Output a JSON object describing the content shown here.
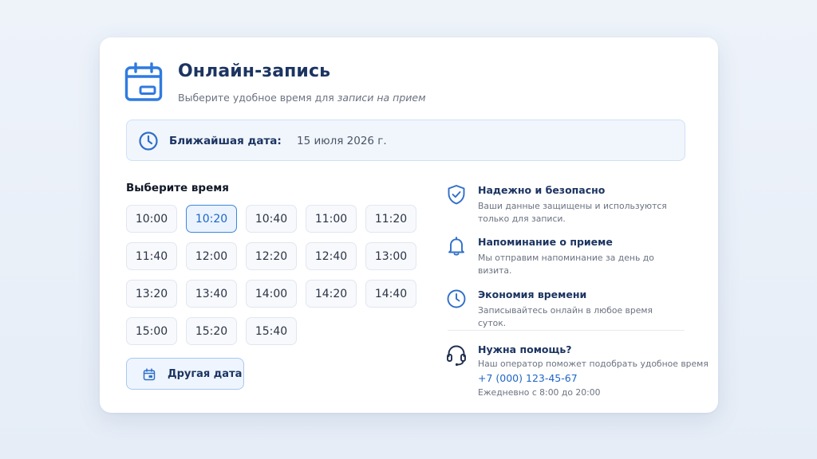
{
  "header": {
    "title": "Онлайн-запись",
    "subtitle_plain": "Выберите удобное время для ",
    "subtitle_italic": "записи на прием",
    "icon": "calendar-icon"
  },
  "nearest": {
    "label": "Ближайшая дата:",
    "value": "15 июля 2026 г.",
    "icon": "clock-icon"
  },
  "time_picker": {
    "title": "Выберите время",
    "selected": "10:20",
    "slots": [
      "10:00",
      "10:20",
      "10:40",
      "11:00",
      "11:20",
      "11:40",
      "12:00",
      "12:20",
      "12:40",
      "13:00",
      "13:20",
      "13:40",
      "14:00",
      "14:20",
      "14:40",
      "15:00",
      "15:20",
      "15:40"
    ]
  },
  "other_date": {
    "label": "Другая дата",
    "icon": "calendar-small-icon"
  },
  "features": [
    {
      "icon": "shield-check-icon",
      "title": "Надежно и безопасно",
      "desc": "Ваши данные защищены и используются только для записи."
    },
    {
      "icon": "bell-icon",
      "title": "Напоминание о приеме",
      "desc": "Мы отправим напоминание за день до визита."
    },
    {
      "icon": "clock-icon",
      "title": "Экономия времени",
      "desc": "Записывайтесь онлайн в любое время суток."
    }
  ],
  "help": {
    "icon": "headset-icon",
    "title": "Нужна помощь?",
    "desc": "Наш оператор поможет подобрать удобное время",
    "phone": "+7 (000) 123-45-67",
    "hours": "Ежедневно с 8:00 до 20:00"
  },
  "colors": {
    "accent": "#3d86e0",
    "title": "#1c3461",
    "muted": "#6b7280"
  }
}
